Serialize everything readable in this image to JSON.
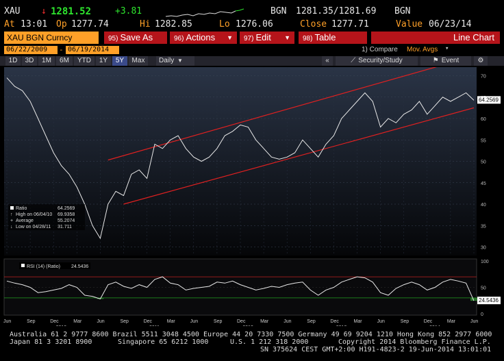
{
  "quote": {
    "ticker": "XAU",
    "arrow": "↓",
    "last": "1281.52",
    "change": "+3.81",
    "source": "BGN",
    "bid_ask": "1281.35/1281.69",
    "source2": "BGN",
    "at_label": "At",
    "time": "13:01",
    "op_label": "Op",
    "open": "1277.74",
    "hi_label": "Hi",
    "high": "1282.85",
    "lo_label": "Lo",
    "low": "1276.06",
    "close_label": "Close",
    "close": "1277.71",
    "value_label": "Value",
    "value_date": "06/23/14"
  },
  "toolbar": {
    "security": "XAU BGN Curncy",
    "save_num": "95)",
    "save_label": "Save As",
    "actions_num": "96)",
    "actions_label": "Actions",
    "edit_num": "97)",
    "edit_label": "Edit",
    "table_num": "98)",
    "table_label": "Table",
    "chart_type": "Line Chart"
  },
  "range": {
    "start": "06/22/2009",
    "sep": "-",
    "end": "06/19/2014",
    "compare": "1) Compare",
    "mov_avgs": "Mov. Avgs"
  },
  "periods": [
    {
      "label": "1D"
    },
    {
      "label": "3D"
    },
    {
      "label": "1M"
    },
    {
      "label": "6M"
    },
    {
      "label": "YTD"
    },
    {
      "label": "1Y"
    },
    {
      "label": "5Y"
    },
    {
      "label": "Max"
    }
  ],
  "period_active": "5Y",
  "frequency": "Daily",
  "side_tools": {
    "collapse": "«",
    "security_study": "Security/Study",
    "event": "Event",
    "settings": "⚙"
  },
  "legend": {
    "ratio_label": "Ratio",
    "ratio_val": "64.2569",
    "high_label": "High on 06/04/10",
    "high_val": "69.9358",
    "avg_label": "Average",
    "avg_val": "55.2074",
    "low_label": "Low on 04/28/11",
    "low_val": "31.711"
  },
  "rsi_legend": {
    "label": "RSI (14) (Ratio)",
    "value": "24.5436"
  },
  "colors": {
    "accent": "#ffa028",
    "toolbar": "#b5141a",
    "up": "#2ee62e",
    "down": "#ff3030",
    "trend": "#e02020",
    "rsi_fill": "#2e8b2e"
  },
  "chart_data": [
    {
      "type": "line",
      "series": [
        {
          "name": "Ratio",
          "x": [
            "2009-06",
            "2009-07",
            "2009-08",
            "2009-09",
            "2009-10",
            "2009-11",
            "2009-12",
            "2010-01",
            "2010-02",
            "2010-03",
            "2010-04",
            "2010-05",
            "2010-06",
            "2010-07",
            "2010-08",
            "2010-09",
            "2010-10",
            "2010-11",
            "2010-12",
            "2011-01",
            "2011-02",
            "2011-03",
            "2011-04",
            "2011-05",
            "2011-06",
            "2011-07",
            "2011-08",
            "2011-09",
            "2011-10",
            "2011-11",
            "2011-12",
            "2012-01",
            "2012-02",
            "2012-03",
            "2012-04",
            "2012-05",
            "2012-06",
            "2012-07",
            "2012-08",
            "2012-09",
            "2012-10",
            "2012-11",
            "2012-12",
            "2013-01",
            "2013-02",
            "2013-03",
            "2013-04",
            "2013-05",
            "2013-06",
            "2013-07",
            "2013-08",
            "2013-09",
            "2013-10",
            "2013-11",
            "2013-12",
            "2014-01",
            "2014-02",
            "2014-03",
            "2014-04",
            "2014-05",
            "2014-06"
          ],
          "values": [
            69.5,
            67.5,
            66.5,
            64,
            60,
            56,
            52,
            49,
            47,
            44,
            40,
            35,
            32,
            40,
            43,
            42,
            47,
            48,
            46,
            54,
            53,
            55,
            56,
            53,
            51,
            50,
            51,
            53,
            56,
            57,
            58.5,
            58,
            55,
            53,
            51,
            50.5,
            51,
            52,
            55,
            53,
            51,
            54,
            56,
            60,
            62,
            64,
            66,
            64,
            58,
            60,
            59,
            61,
            62,
            64,
            61,
            63,
            65,
            64,
            65,
            66,
            64.26
          ]
        }
      ],
      "trendlines": [
        {
          "name": "upper",
          "from": [
            "2010-07",
            50.3
          ],
          "to": [
            "2014-03",
            73
          ]
        },
        {
          "name": "lower",
          "from": [
            "2010-09",
            40
          ],
          "to": [
            "2014-06",
            62.5
          ]
        }
      ],
      "yticks": [
        30,
        35,
        40,
        45,
        50,
        55,
        60,
        65,
        70
      ],
      "ylim": [
        28,
        72
      ],
      "last_label": "64.2569",
      "xticks": [
        "Jun",
        "Sep",
        "Dec",
        "Mar",
        "Jun",
        "Sep",
        "Dec",
        "Mar",
        "Jun",
        "Sep",
        "Dec",
        "Mar",
        "Jun",
        "Sep",
        "Dec",
        "Mar",
        "Jun",
        "Sep",
        "Dec",
        "Mar",
        "Jun"
      ],
      "years": [
        "2010",
        "2011",
        "2012",
        "2013",
        "2014"
      ]
    },
    {
      "type": "line",
      "series": [
        {
          "name": "RSI (14) (Ratio)",
          "values": [
            62,
            58,
            55,
            50,
            40,
            42,
            45,
            48,
            55,
            50,
            35,
            33,
            28,
            55,
            60,
            52,
            48,
            55,
            50,
            65,
            70,
            58,
            55,
            45,
            48,
            50,
            52,
            60,
            58,
            62,
            55,
            50,
            45,
            48,
            52,
            50,
            55,
            58,
            60,
            45,
            35,
            45,
            50,
            60,
            65,
            70,
            68,
            60,
            40,
            35,
            48,
            55,
            60,
            55,
            45,
            50,
            60,
            65,
            62,
            58,
            24.54
          ]
        }
      ],
      "yticks": [
        0,
        50,
        100
      ],
      "ylim": [
        0,
        100
      ],
      "overbought": 70,
      "oversold": 30,
      "last_label": "24.5436"
    }
  ],
  "footer": {
    "line1": "Australia 61 2 9777 8600 Brazil 5511 3048 4500 Europe 44 20 7330 7500 Germany 49 69 9204 1210 Hong Kong 852 2977 6000",
    "line2a": "Japan 81 3 3201 8900",
    "line2b": "Singapore 65 6212 1000",
    "line2c": "U.S. 1 212 318 2000",
    "line2d": "Copyright 2014 Bloomberg Finance L.P.",
    "line3": "SN 375624 CEST GMT+2:00 H191-4823-2 19-Jun-2014 13:01:01"
  }
}
